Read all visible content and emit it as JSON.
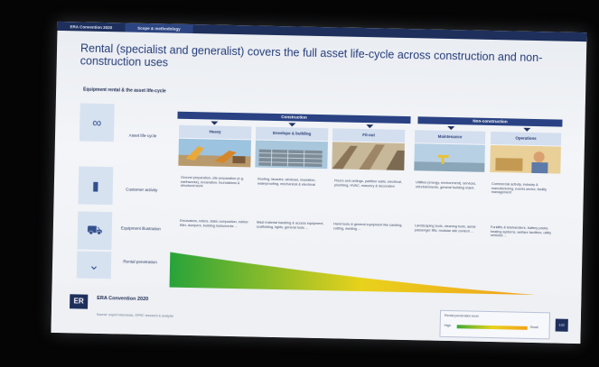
{
  "tabs": [
    "ERA Convention 2020",
    "Scope & methodology"
  ],
  "title": "Rental (specialist and generalist) covers the full asset life-cycle across construction and non-construction uses",
  "subtitle": "Equipment rental & the asset life-cycle",
  "rows": [
    {
      "label": "Asset life-cycle",
      "icon": "infinity-icon"
    },
    {
      "label": "Customer activity",
      "icon": "building-icon"
    },
    {
      "label": "Equipment illustration",
      "icon": "forklift-icon"
    },
    {
      "label": "Rental penetration",
      "icon": "chevron-down-icon"
    }
  ],
  "groups": {
    "construction": "Construction",
    "non_construction": "Non-construction"
  },
  "columns": [
    {
      "label": "Heavy",
      "activity": "Ground preparation, site preparation (e.g. earthworks), excavation, foundations & structural work",
      "equipment": "Excavators, rollers, static compaction, rubber tiller, dumpers, building instruments ..."
    },
    {
      "label": "Envelope & building",
      "activity": "Roofing, facades, windows, insulation, waterproofing, mechanical & electrical",
      "equipment": "Mast material handling & access equipment, scaffolding, lights, general tools ..."
    },
    {
      "label": "Fit-out",
      "activity": "Floors and ceilings, partition walls, electrical, plumbing, HVAC, masonry & decoration",
      "equipment": "Hand tools & general equipment like sanding, cutting, welding ..."
    },
    {
      "label": "Maintenance",
      "activity": "Utilities (energy, environment), services, refurbishments, general building maint.",
      "equipment": "Landscaping tools, cleaning tools, aerial passenger lifts, modular site content ..."
    },
    {
      "label": "Operations",
      "activity": "Commercial activity, industry & manufacturing, events sector, facility management",
      "equipment": "Forklifts & telehandlers, battery packs, heating systems, welfare facilities, utility vehicles ..."
    }
  ],
  "footer": {
    "logo": "ER",
    "conference": "ERA Convention 2020",
    "source": "Source: expert interviews, OPRC research & analysis",
    "legend_title": "Rental penetration level",
    "legend_low": "High",
    "legend_high": "Small",
    "page": "192"
  },
  "colors": {
    "navy": "#1e2f5c",
    "accent": "#2a4283",
    "gradient_start": "#27a33a",
    "gradient_mid": "#e8d21c",
    "gradient_end": "#f39a1a"
  }
}
